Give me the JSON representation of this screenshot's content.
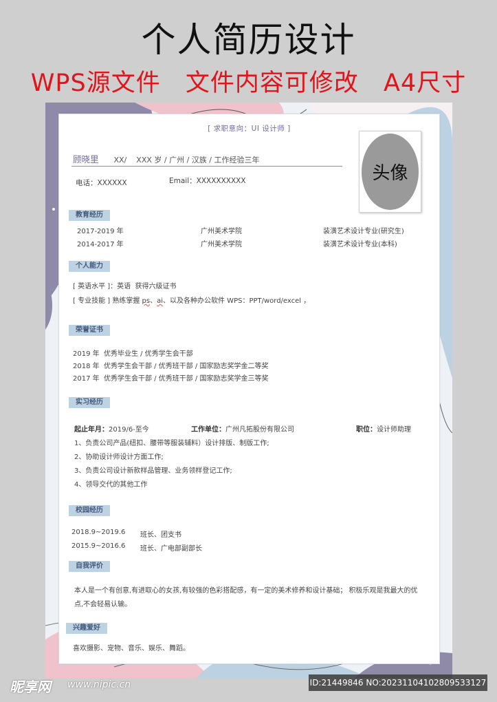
{
  "header": {
    "title": "个人简历设计",
    "subtitle_parts": [
      "WPS源文件",
      "文件内容可修改",
      "A4尺寸"
    ]
  },
  "resume": {
    "objective": "[ 求职意向：UI 设计师 ]",
    "name": "顾晓里",
    "basic_info": "XX/    XXX 岁 / 广州 / 汉族 / 工作经验三年",
    "phone": "电话：XXXXXX",
    "email": "Email：XXXXXXXXXX",
    "photo_label": "头像",
    "sections": {
      "education": {
        "title": "教育经历",
        "rows": [
          {
            "period": "2017-2019 年",
            "school": "广州美术学院",
            "major": "装潢艺术设计专业(研究生)"
          },
          {
            "period": "2014-2017 年",
            "school": "广州美术学院",
            "major": "装潢艺术设计专业(本科)"
          }
        ]
      },
      "skills": {
        "title": "个人能力",
        "english_label": "[ 英语水平 ]：",
        "english_value": "英语  获得六级证书",
        "pro_label": "[ 专业技能 ] ",
        "pro_prefix": "熟练掌握 ",
        "pro_ps": "ps",
        "pro_sep": "、",
        "pro_ai": "ai",
        "pro_suffix": "、以及各种办公软件 WPS：PPT/word/excel ，"
      },
      "honors": {
        "title": "荣誉证书",
        "rows": [
          "2019 年  优秀毕业生 / 优秀学生会干部",
          "2018 年  优秀学生会干部 / 优秀班干部 / 国家励志奖学金二等奖",
          "2017 年  优秀学生会干部 / 优秀班干部 / 国家励志奖学金三等奖"
        ]
      },
      "internship": {
        "title": "实习经历",
        "start_label": "起止年月：",
        "start_value": "2019/6-至今",
        "company_label": "工作单位：",
        "company_value": "广州凡拓股份有限公司",
        "position_label": "职位：",
        "position_value": "设计师助理",
        "items": [
          "1、负责公司产品(纽扣、腰带等服装辅料）设计排版、制版工作;",
          "2、协助设计师设计方面工作;",
          "3、负责公司设计新款样品管理、业务领样登记工作;",
          "4、领导交代的其他工作"
        ]
      },
      "campus": {
        "title": "校园经历",
        "rows": [
          {
            "period": "2018.9~2019.6",
            "role": "班长、团支书"
          },
          {
            "period": "2015.9~2016.6",
            "role": "班长、广电部副部长"
          }
        ]
      },
      "self_eval": {
        "title": "自我评价",
        "text": "本人是一个有创意,有进取心的女孩,有较强的色彩搭配感，有一定的美术修养和设计基础；  积极乐观是我最大的优点,不会轻易认输。"
      },
      "hobbies": {
        "title": "兴趣爱好",
        "text": "喜欢摄影、宠物、音乐、娱乐、舞蹈。"
      }
    }
  },
  "watermark": {
    "logo": "昵享网",
    "url": "www.nipic.cn",
    "id": "ID:21449846 NO:20231104102809533127"
  }
}
